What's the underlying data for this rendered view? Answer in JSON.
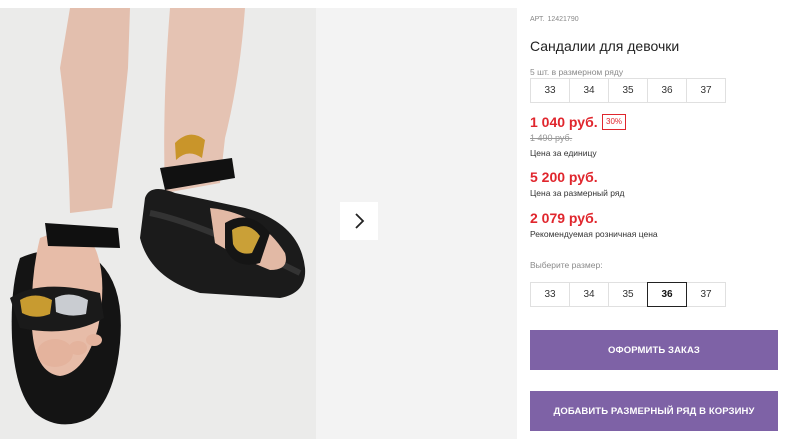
{
  "product": {
    "article_label": "АРТ.",
    "article_number": "12421790",
    "title": "Сандалии для девочки"
  },
  "size_row": {
    "caption": "5 шт. в размерном ряду",
    "sizes": [
      "33",
      "34",
      "35",
      "36",
      "37"
    ]
  },
  "prices": {
    "unit_price": "1 040 руб.",
    "discount": "30%",
    "old_price": "1 490 руб.",
    "unit_note": "Цена за единицу",
    "row_price": "5 200 руб.",
    "row_note": "Цена за размерный ряд",
    "retail_price": "2 079 руб.",
    "retail_note": "Рекомендуемая розничная цена"
  },
  "size_select": {
    "caption": "Выберите размер:",
    "options": [
      "33",
      "34",
      "35",
      "36",
      "37"
    ],
    "selected": "36"
  },
  "buttons": {
    "order": "Оформить заказ",
    "add_row": "Добавить размерный ряд в корзину"
  },
  "gallery": {
    "next_icon": "chevron-right-icon"
  },
  "colors": {
    "accent": "#7e62a6",
    "price": "#e0262d"
  }
}
